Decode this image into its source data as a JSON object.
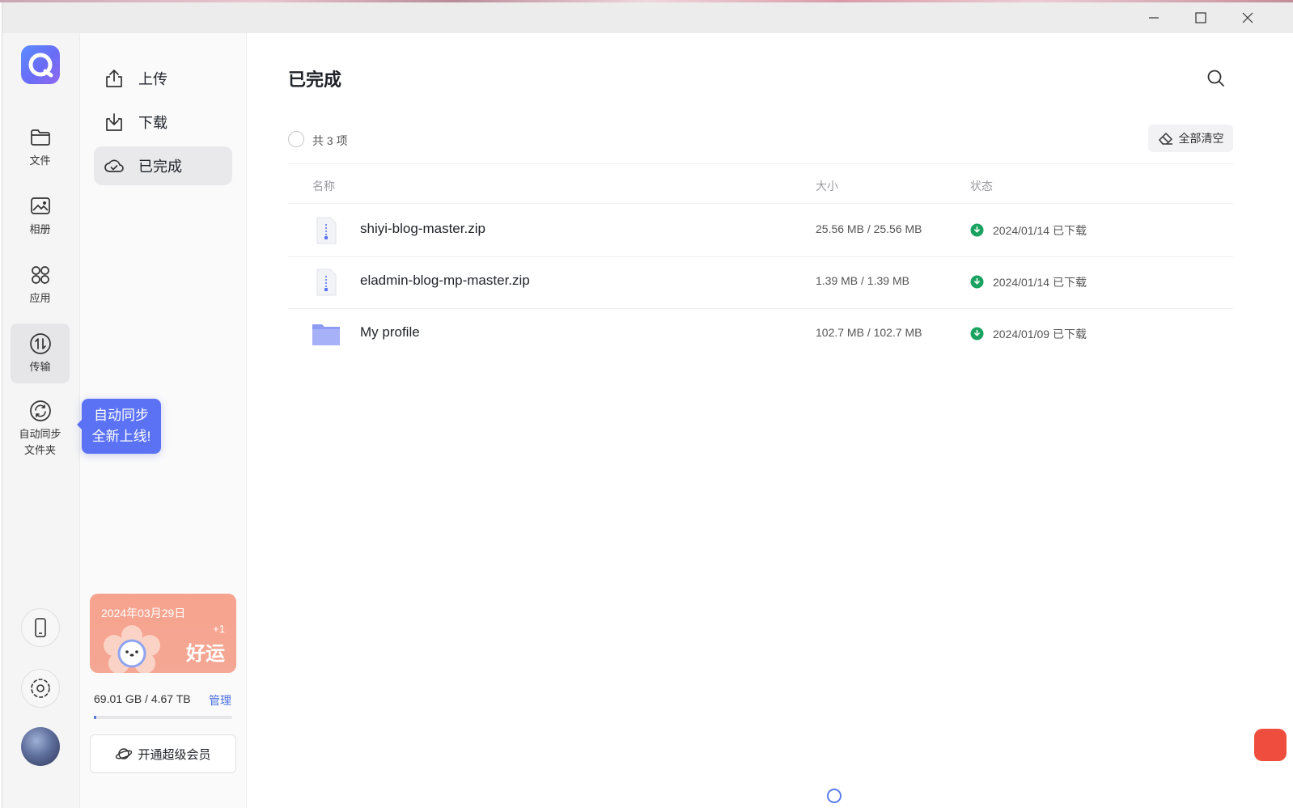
{
  "window": {
    "controls": {
      "minimize": "—",
      "maximize": "☐",
      "close": "✕"
    }
  },
  "rail": {
    "items": [
      {
        "label": "文件",
        "icon": "folder-icon"
      },
      {
        "label": "相册",
        "icon": "photo-icon"
      },
      {
        "label": "应用",
        "icon": "apps-icon"
      },
      {
        "label": "传输",
        "icon": "transfer-icon",
        "active": true
      },
      {
        "label": "自动同步\n文件夹",
        "label_line1": "自动同步",
        "label_line2": "文件夹",
        "icon": "sync-icon"
      }
    ],
    "bottom": [
      "phone-icon",
      "settings-icon",
      "avatar"
    ]
  },
  "tooltip": {
    "line1": "自动同步",
    "line2": "全新上线!"
  },
  "subnav": {
    "items": [
      {
        "label": "上传",
        "icon": "upload-icon"
      },
      {
        "label": "下载",
        "icon": "download-icon"
      },
      {
        "label": "已完成",
        "icon": "cloud-done-icon",
        "active": true
      }
    ]
  },
  "luck_card": {
    "date": "2024年03月29日",
    "plus": "+1",
    "word": "好运"
  },
  "storage": {
    "text": "69.01 GB / 4.67 TB",
    "manage": "管理",
    "used_fraction": 0.0144
  },
  "vip": {
    "label": "开通超级会员"
  },
  "main": {
    "title": "已完成",
    "count": "共 3 项",
    "clear_all": "全部清空",
    "columns": {
      "name": "名称",
      "size": "大小",
      "status": "状态"
    },
    "rows": [
      {
        "name": "shiyi-blog-master.zip",
        "size": "25.56 MB / 25.56 MB",
        "status": "2024/01/14 已下载",
        "type": "zip"
      },
      {
        "name": "eladmin-blog-mp-master.zip",
        "size": "1.39 MB / 1.39 MB",
        "status": "2024/01/14 已下载",
        "type": "zip"
      },
      {
        "name": "My profile",
        "size": "102.7 MB / 102.7 MB",
        "status": "2024/01/09 已下载",
        "type": "folder"
      }
    ]
  },
  "colors": {
    "accent": "#5b72f5",
    "success": "#1aa260",
    "link": "#4a6ee0"
  }
}
